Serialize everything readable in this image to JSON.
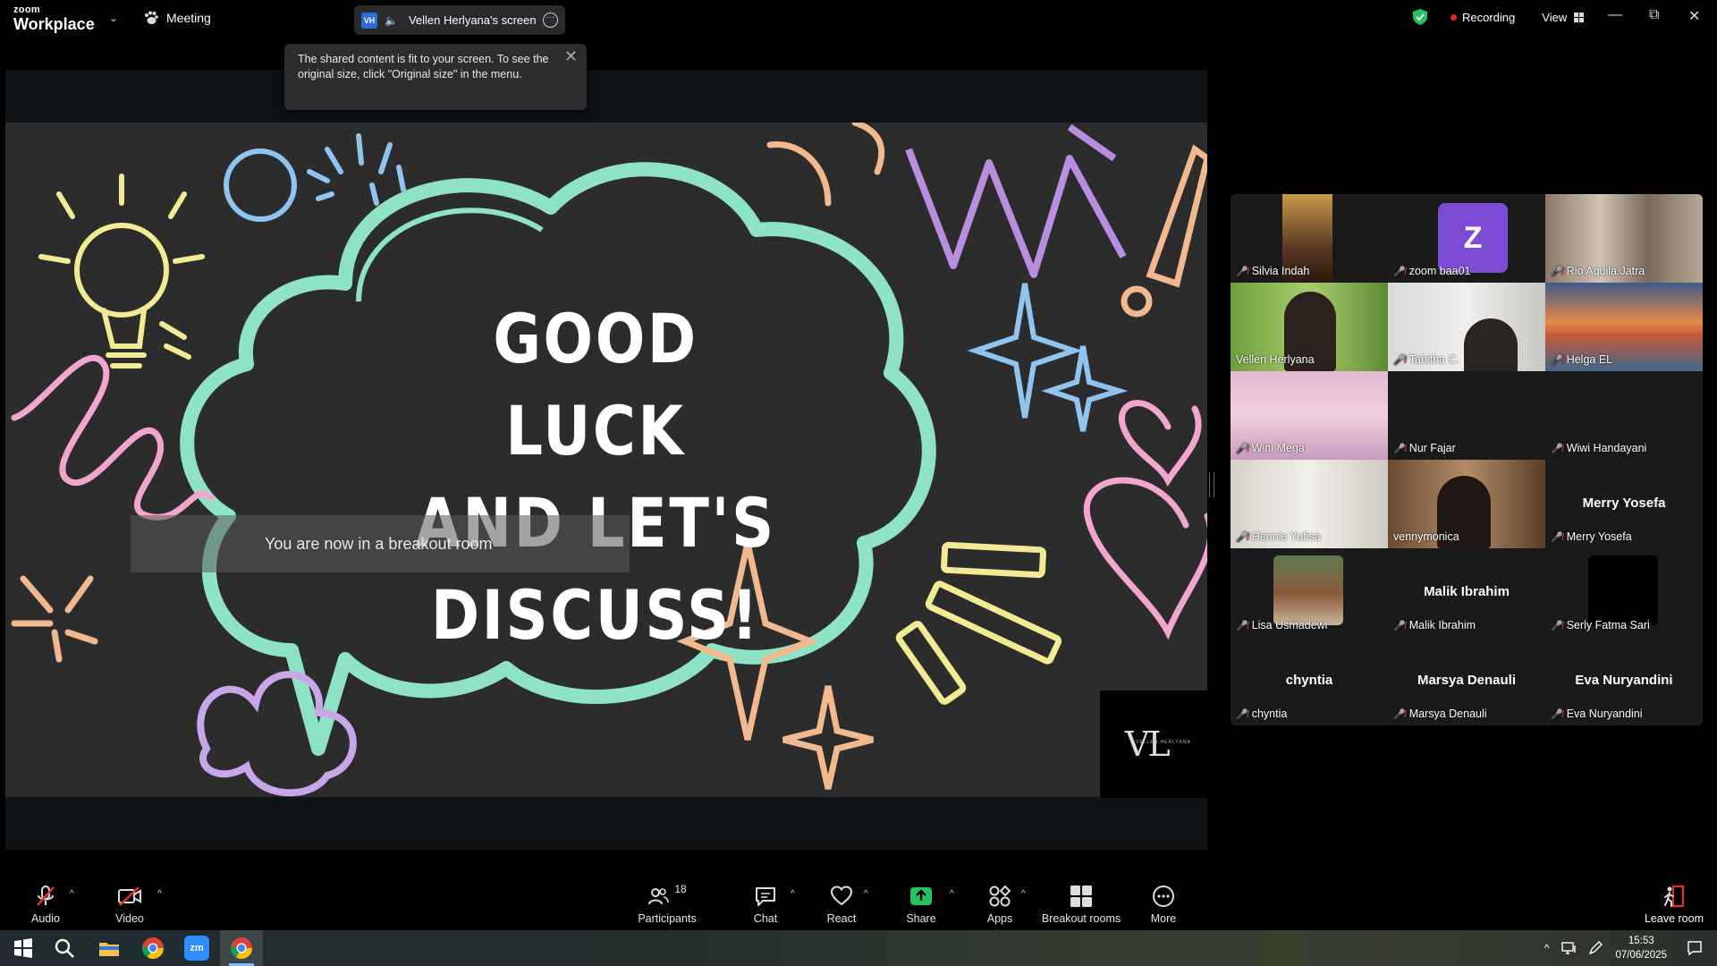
{
  "titlebar": {
    "logo_small": "zoom",
    "logo_big": "Workplace",
    "meeting_label": "Meeting",
    "share_badge": "VH",
    "share_name": "Vellen Herlyana's screen",
    "recording_label": "Recording",
    "view_label": "View"
  },
  "tooltip": {
    "text": "The shared content is fit to your screen. To see the original size, click \"Original size\" in the menu."
  },
  "slide": {
    "line1": "GOOD LUCK",
    "line2": "AND LET'S",
    "line3": "DISCUSS!",
    "logo_text": "VL",
    "logo_sub": "VELLEN HERLYANA"
  },
  "breakout_message": "You are now in a breakout room",
  "participants": [
    {
      "name": "Silvia Indah",
      "video": true,
      "muted": true
    },
    {
      "name": "zoom baa01",
      "video": false,
      "avatar_letter": "Z",
      "muted": true
    },
    {
      "name": "Rio Aquila Jatra",
      "video": true,
      "muted": true
    },
    {
      "name": "Vellen Herlyana",
      "video": true,
      "muted": false,
      "active_speaker": true
    },
    {
      "name": "Tabitha C.",
      "video": true,
      "muted": true
    },
    {
      "name": "Helga EL",
      "video": true,
      "muted": true
    },
    {
      "name": "Wini Mega",
      "video": true,
      "muted": true
    },
    {
      "name": "Nur Fajar",
      "video": false,
      "muted": true
    },
    {
      "name": "Wiwi Handayani",
      "video": false,
      "muted": true
    },
    {
      "name": "Hennie Yufisa",
      "video": true,
      "muted": true
    },
    {
      "name": "vennymonica",
      "video": true,
      "muted": false
    },
    {
      "name": "Merry Yosefa",
      "video": false,
      "center_name": "Merry Yosefa",
      "muted": true
    },
    {
      "name": "Lisa Usmadewi",
      "video": true,
      "muted": true
    },
    {
      "name": "Malik Ibrahim",
      "video": false,
      "center_name": "Malik Ibrahim",
      "muted": true
    },
    {
      "name": "Serly Fatma Sari",
      "video": true,
      "muted": true
    },
    {
      "name": "chyntia",
      "video": false,
      "center_name": "chyntia",
      "muted": true
    },
    {
      "name": "Marsya Denauli",
      "video": false,
      "center_name": "Marsya Denauli",
      "muted": true
    },
    {
      "name": "Eva Nuryandini",
      "video": false,
      "center_name": "Eva Nuryandini",
      "muted": true
    }
  ],
  "toolbar": {
    "audio": "Audio",
    "video": "Video",
    "participants": "Participants",
    "participants_count": "18",
    "chat": "Chat",
    "react": "React",
    "share": "Share",
    "apps": "Apps",
    "breakout": "Breakout rooms",
    "more": "More",
    "leave": "Leave room"
  },
  "taskbar": {
    "time": "15:53",
    "date": "07/06/2025"
  },
  "colors": {
    "active_speaker": "#23d96d",
    "share_green": "#23c45e",
    "muted_red": "#e0312f",
    "avatar_purple": "#7b4cd3"
  }
}
